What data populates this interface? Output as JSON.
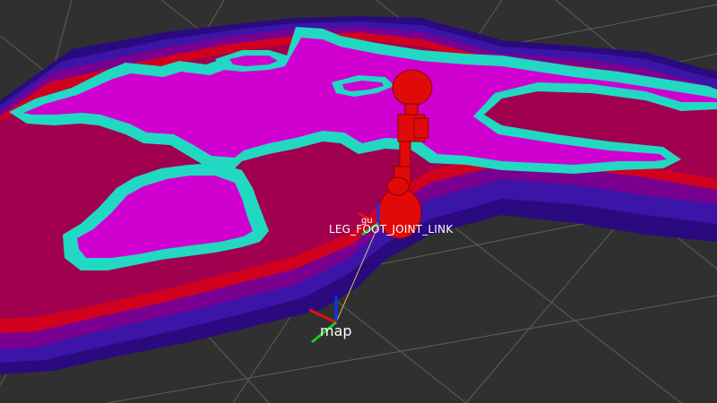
{
  "viewport": {
    "background_color": "#303030",
    "grid_color": "#5e5e5e"
  },
  "costmap": {
    "colors": {
      "lethal": "#d000d0",
      "inscribed": "#21d9c2",
      "high": "#d1001f",
      "mid": "#7a0090",
      "low": "#3c14a8",
      "edge": "#2a0a7e"
    }
  },
  "robot": {
    "color": "#e00a0a"
  },
  "frames": {
    "map_label": "map",
    "foot_label": "LEG_FOOT_JOINT_LINK",
    "foot_label_partial": "gu",
    "axis_colors": {
      "x": "#e01010",
      "y": "#10d010",
      "z": "#1030ff"
    },
    "link_line_color": "#d8c060"
  }
}
